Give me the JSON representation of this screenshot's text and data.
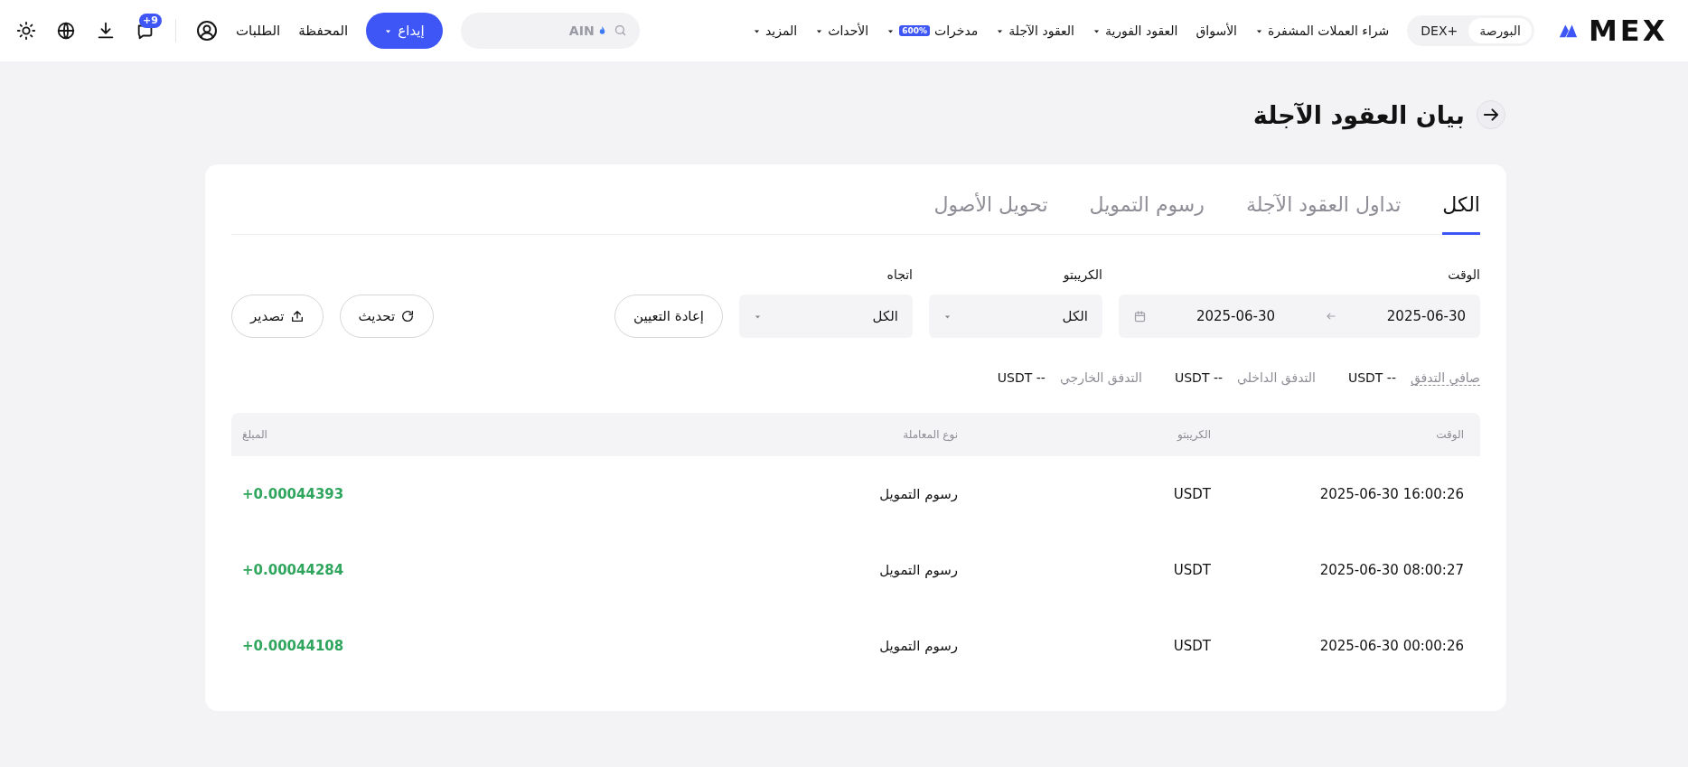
{
  "header": {
    "logo": "MEX",
    "exchange_toggle": [
      {
        "label": "البورصة",
        "selected": true
      },
      {
        "label": "DEX+",
        "selected": false
      }
    ],
    "nav": [
      {
        "label": "شراء العملات المشفرة",
        "dropdown": true
      },
      {
        "label": "الأسواق",
        "dropdown": false
      },
      {
        "label": "العقود الفورية",
        "dropdown": true
      },
      {
        "label": "العقود الآجلة",
        "dropdown": true
      },
      {
        "label": "مدخرات",
        "badge": "600%",
        "dropdown": true
      },
      {
        "label": "الأحداث",
        "dropdown": true
      },
      {
        "label": "المزيد",
        "dropdown": true
      }
    ],
    "search": {
      "placeholder": "AIN"
    },
    "deposit_button": "إيداع",
    "links": [
      "المحفظة",
      "الطلبات"
    ],
    "messages_badge": "+9"
  },
  "page": {
    "title": "بيان العقود الآجلة"
  },
  "tabs": [
    {
      "label": "الكل",
      "selected": true
    },
    {
      "label": "تداول العقود الآجلة",
      "selected": false
    },
    {
      "label": "رسوم التمويل",
      "selected": false
    },
    {
      "label": "تحويل الأصول",
      "selected": false
    }
  ],
  "filters": {
    "time": {
      "label": "الوقت",
      "start": "2025-06-30",
      "end": "2025-06-30"
    },
    "crypto": {
      "label": "الكريبتو",
      "value": "الكل"
    },
    "direction": {
      "label": "اتجاه",
      "value": "الكل"
    },
    "reset_button": "إعادة التعيين",
    "refresh_button": "تحديث",
    "export_button": "تصدير"
  },
  "summary": [
    {
      "label": "صافي التدفق",
      "value": "-- USDT",
      "has_tooltip": true
    },
    {
      "label": "التدفق الداخلي",
      "value": "-- USDT",
      "has_tooltip": false
    },
    {
      "label": "التدفق الخارجي",
      "value": "-- USDT",
      "has_tooltip": false
    }
  ],
  "table": {
    "columns": [
      "الوقت",
      "الكريبتو",
      "نوع المعاملة",
      "المبلغ"
    ],
    "rows": [
      {
        "time": "2025-06-30 16:00:26",
        "crypto": "USDT",
        "type": "رسوم التمويل",
        "amount": "+0.00044393"
      },
      {
        "time": "2025-06-30 08:00:27",
        "crypto": "USDT",
        "type": "رسوم التمويل",
        "amount": "+0.00044284"
      },
      {
        "time": "2025-06-30 00:00:26",
        "crypto": "USDT",
        "type": "رسوم التمويل",
        "amount": "+0.00044108"
      }
    ]
  }
}
